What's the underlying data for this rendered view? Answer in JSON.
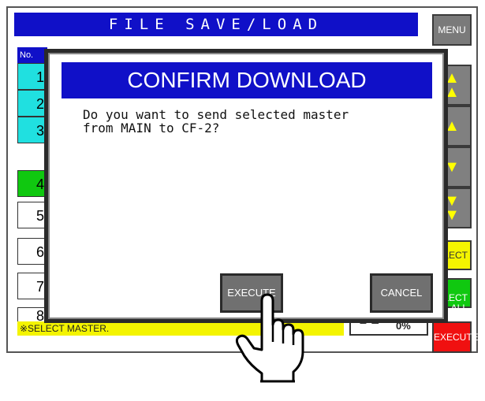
{
  "window": {
    "title": "FILE SAVE/LOAD"
  },
  "right_panel": {
    "menu_label": "MENU",
    "select_label": "LECT",
    "select_all_label": "LECT\nALL",
    "execute_label": "EXECUTE"
  },
  "list": {
    "header": "No.",
    "rows": [
      {
        "num": "1",
        "color": "#20e0e0"
      },
      {
        "num": "2",
        "color": "#20e0e0"
      },
      {
        "num": "3",
        "color": "#20e0e0"
      },
      {
        "num": "4",
        "color": "#10c810"
      },
      {
        "num": "5",
        "color": "#ffffff"
      },
      {
        "num": "6",
        "color": "#ffffff"
      },
      {
        "num": "7",
        "color": "#ffffff"
      },
      {
        "num": "8",
        "color": "#ffffff"
      }
    ]
  },
  "status": {
    "message": "※SELECT MASTER."
  },
  "progress": {
    "percent": "0%"
  },
  "dialog": {
    "title": "CONFIRM DOWNLOAD",
    "message": "Do you want to send selected master\nfrom MAIN to CF-2?",
    "execute_label": "EXECUTE",
    "cancel_label": "CANCEL"
  },
  "colors": {
    "title_blue": "#1010c8",
    "status_yellow": "#f4f400",
    "button_gray": "#707070"
  }
}
